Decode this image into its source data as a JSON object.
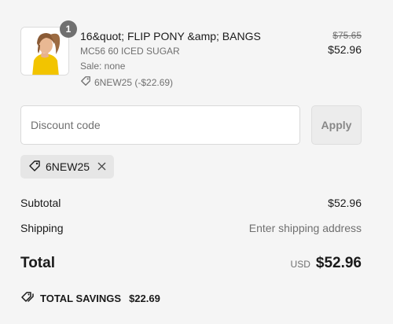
{
  "product": {
    "quantity": "1",
    "title": "16&quot; FLIP PONY &amp; BANGS",
    "variant": "MC56 60 ICED SUGAR",
    "sale": "Sale: none",
    "discount_line": "6NEW25 (-$22.69)",
    "original_price": "$75.65",
    "price": "$52.96",
    "icons": {
      "discount": "tag-icon"
    }
  },
  "discount": {
    "placeholder": "Discount code",
    "value": "",
    "apply_label": "Apply",
    "applied_code": "6NEW25"
  },
  "summary": {
    "subtotal_label": "Subtotal",
    "subtotal_value": "$52.96",
    "shipping_label": "Shipping",
    "shipping_value": "Enter shipping address",
    "total_label": "Total",
    "currency": "USD",
    "total_value": "$52.96",
    "savings_label": "TOTAL SAVINGS",
    "savings_value": "$22.69"
  },
  "colors": {
    "background": "#f5f5f5",
    "muted_text": "#707070",
    "badge": "#707070",
    "chip": "#e6e6e6"
  }
}
